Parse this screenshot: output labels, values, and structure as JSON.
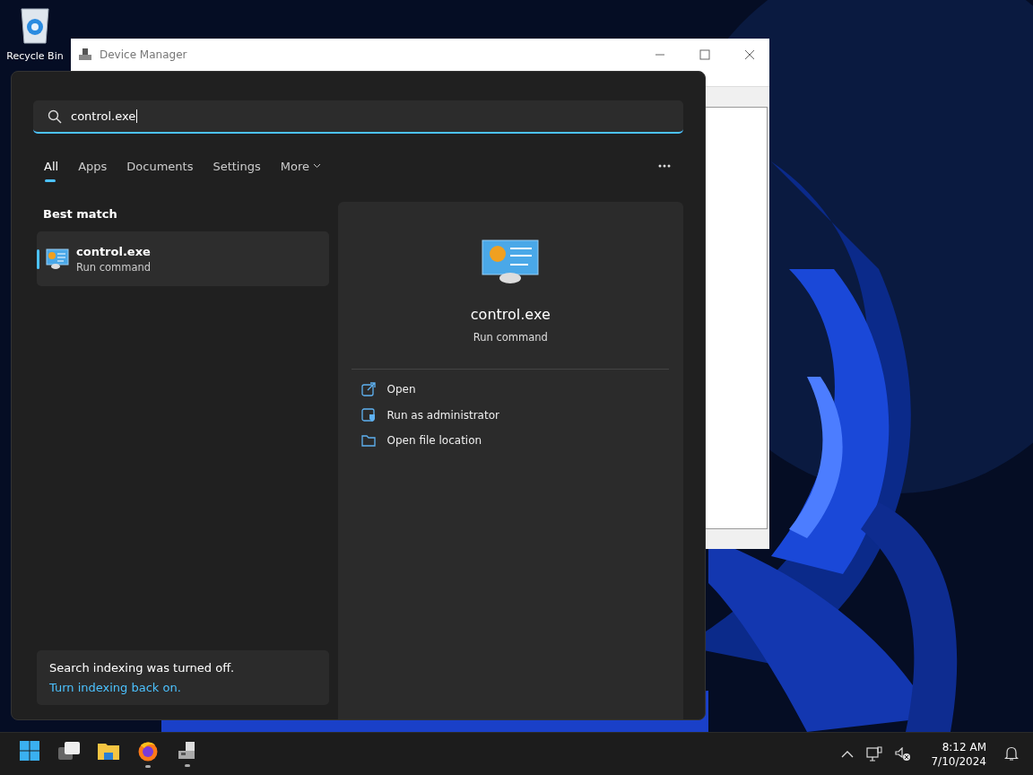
{
  "desktop": {
    "icons": [
      {
        "label": "Recycle Bin"
      }
    ]
  },
  "background_window": {
    "title": "Device Manager"
  },
  "search": {
    "value": "control.exe",
    "tabs": [
      {
        "label": "All",
        "selected": true
      },
      {
        "label": "Apps",
        "selected": false
      },
      {
        "label": "Documents",
        "selected": false
      },
      {
        "label": "Settings",
        "selected": false
      },
      {
        "label": "More",
        "selected": false,
        "kind": "dropdown"
      }
    ],
    "best_match": {
      "heading": "Best match",
      "items": [
        {
          "name": "control.exe",
          "type": "Run command",
          "selected": true
        }
      ]
    },
    "preview": {
      "name": "control.exe",
      "type": "Run command",
      "actions": [
        {
          "label": "Open",
          "kind": "open"
        },
        {
          "label": "Run as administrator",
          "kind": "admin"
        },
        {
          "label": "Open file location",
          "kind": "folder"
        }
      ]
    },
    "notice": {
      "text": "Search indexing was turned off.",
      "link": "Turn indexing back on."
    }
  },
  "taskbar": {
    "apps": [
      {
        "kind": "start",
        "running": false
      },
      {
        "kind": "taskview",
        "running": false
      },
      {
        "kind": "explorer",
        "running": false
      },
      {
        "kind": "firefox",
        "running": true
      },
      {
        "kind": "devmgr",
        "running": true
      }
    ],
    "clock": {
      "time": "8:12 AM",
      "date": "7/10/2024"
    }
  }
}
